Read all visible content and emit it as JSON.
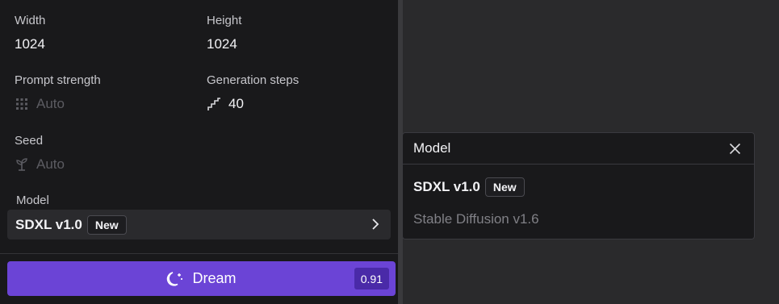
{
  "settings": {
    "width": {
      "label": "Width",
      "value": "1024"
    },
    "height": {
      "label": "Height",
      "value": "1024"
    },
    "prompt_strength": {
      "label": "Prompt strength",
      "value": "Auto",
      "icon": "grid-dots-icon"
    },
    "generation_steps": {
      "label": "Generation steps",
      "value": "40",
      "icon": "steps-icon"
    },
    "seed": {
      "label": "Seed",
      "value": "Auto",
      "icon": "sprout-icon"
    },
    "model": {
      "label": "Model",
      "selected": "SDXL v1.0",
      "badge": "New",
      "icon": "chevron-right-icon"
    }
  },
  "dream_button": {
    "label": "Dream",
    "cost": "0.91",
    "icon": "moon-stars-icon"
  },
  "model_popover": {
    "title": "Model",
    "close_icon": "close-icon",
    "options": [
      {
        "name": "SDXL v1.0",
        "badge": "New",
        "selected": true
      },
      {
        "name": "Stable Diffusion v1.6",
        "selected": false
      }
    ]
  },
  "colors": {
    "accent": "#6b44d6",
    "accent_dark": "#4a2aa8",
    "panel_bg": "#19191b",
    "canvas_bg": "#2a2a2c"
  }
}
